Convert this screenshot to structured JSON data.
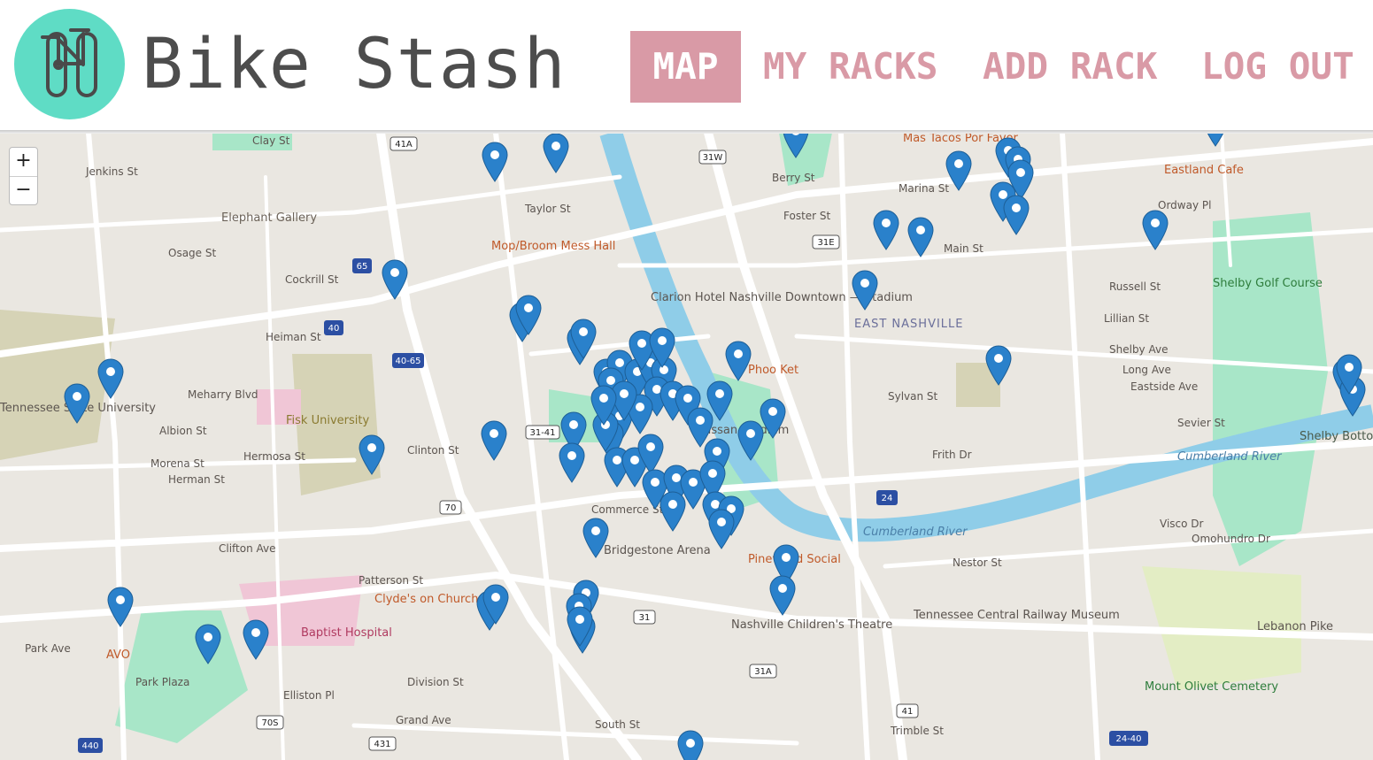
{
  "app": {
    "title": "Bike Stash",
    "brand_color": "#5fdcc5",
    "accent_color": "#d99aa6",
    "logo_icon": "bicycle-icon"
  },
  "nav": {
    "map": "MAP",
    "my_racks": "MY RACKS",
    "add_rack": "ADD RACK",
    "log_out": "LOG OUT",
    "active": "MAP"
  },
  "map": {
    "zoom_in": "+",
    "zoom_out": "−",
    "marker_color": "#2a81cb",
    "marker_icon": "map-marker-icon",
    "labels": [
      "Elephant Gallery",
      "Mop/Broom Mess Hall",
      "Clarion Hotel Nashville Downtown — Stadium",
      "Mas Tacos Por Favor",
      "Eastland Cafe",
      "Shelby Golf Course",
      "EAST NASHVILLE",
      "Phoo Ket",
      "Fisk University",
      "Bridgestone Arena",
      "Pinewood Social",
      "Clyde's on Church",
      "Baptist Hospital",
      "Nashville Children's Theatre",
      "Tennessee Central Railway Museum",
      "Mount Olivet Cemetery",
      "Cumberland River",
      "AVO",
      "Shelby Bottoms Nature Center",
      "Tennessee State University",
      "Nissan Stadium",
      "Cumberland River",
      "Lebanon Pike",
      "Jenkins St",
      "Clay St",
      "Taylor St",
      "Osage St",
      "Cockrill St",
      "Heiman St",
      "Meharry Blvd",
      "Albion St",
      "Morena St",
      "Herman St",
      "Hermosa St",
      "Clinton St",
      "Clifton Ave",
      "Patterson St",
      "Park Ave",
      "Park Plaza",
      "Elliston Pl",
      "Division St",
      "Grand Ave",
      "South St",
      "Berry St",
      "Foster St",
      "Marina St",
      "Main St",
      "Ordway Pl",
      "Russell St",
      "Lillian St",
      "Shelby Ave",
      "Long Ave",
      "Eastside Ave",
      "Sevier St",
      "Sylvan St",
      "Frith Dr",
      "Nestor St",
      "Visco Dr",
      "Omohundro Dr",
      "Trimble St",
      "Commerce St"
    ],
    "roads": [
      "41A",
      "31W",
      "31E",
      "65",
      "40",
      "40-65",
      "31-41",
      "70",
      "24",
      "440",
      "70S",
      "431",
      "31",
      "31A",
      "41",
      "24-40"
    ]
  }
}
